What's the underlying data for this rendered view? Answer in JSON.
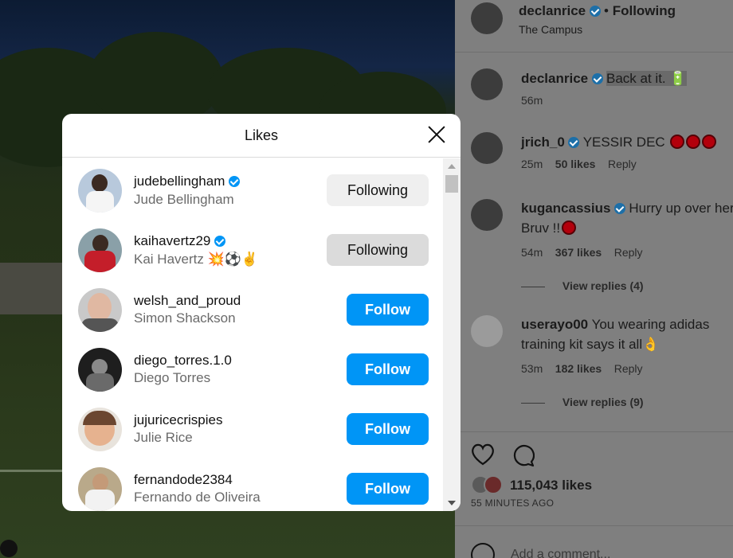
{
  "post": {
    "author": "declanrice",
    "follow_status": "Following",
    "location": "The Campus",
    "caption_author": "declanrice",
    "caption": "Back at it. 🔋",
    "caption_time": "56m",
    "likes_count": "115,043 likes",
    "time_ago": "55 MINUTES AGO",
    "add_comment_placeholder": "Add a comment..."
  },
  "comments": [
    {
      "user": "jrich_0",
      "text": "YESSIR DEC",
      "time": "25m",
      "likes": "50 likes",
      "reply": "Reply"
    },
    {
      "user": "kugancassius",
      "text": "Hurry up over here",
      "text2": "Bruv !!",
      "time": "54m",
      "likes": "367 likes",
      "reply": "Reply",
      "view_replies": "View replies (4)"
    },
    {
      "user": "userayo00",
      "text": "You wearing adidas",
      "text2": "training kit says it all👌",
      "time": "53m",
      "likes": "182 likes",
      "reply": "Reply",
      "view_replies": "View replies (9)"
    }
  ],
  "modal": {
    "title": "Likes",
    "items": [
      {
        "username": "judebellingham",
        "fullname": "Jude Bellingham",
        "verified": true,
        "button": "Following",
        "avatar_color": "#b8c9dc"
      },
      {
        "username": "kaihavertz29",
        "fullname": "Kai Havertz 💥⚽✌️",
        "verified": true,
        "button": "Following",
        "avatar_color": "#b81f2a"
      },
      {
        "username": "welsh_and_proud",
        "fullname": "Simon Shackson",
        "verified": false,
        "button": "Follow",
        "avatar_color": "#d9b8a5"
      },
      {
        "username": "diego_torres.1.0",
        "fullname": "Diego Torres",
        "verified": false,
        "button": "Follow",
        "avatar_color": "#1e1e1e"
      },
      {
        "username": "jujuricecrispies",
        "fullname": "Julie Rice",
        "verified": false,
        "button": "Follow",
        "avatar_color": "#b07a5a"
      },
      {
        "username": "fernandode2384",
        "fullname": "Fernando de Oliveira",
        "verified": false,
        "button": "Follow",
        "avatar_color": "#9a8f77"
      }
    ]
  },
  "colors": {
    "follow_blue": "#0095f6",
    "following_grey": "#efefef",
    "verified_blue": "#0095f6"
  }
}
